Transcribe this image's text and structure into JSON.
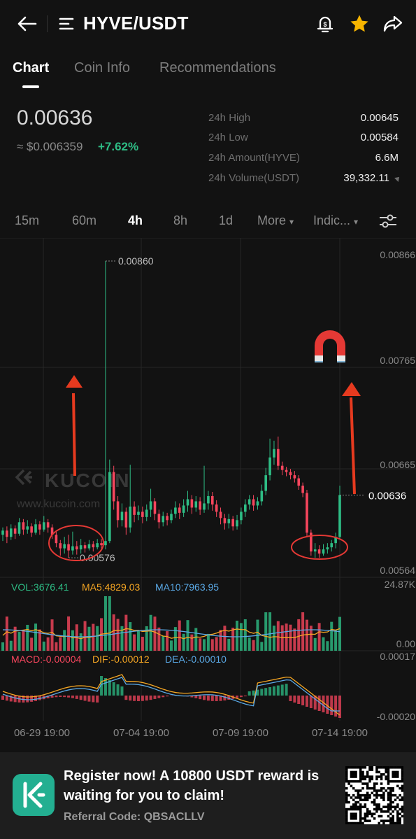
{
  "header": {
    "pair": "HYVE/USDT",
    "icons": [
      "back-arrow-icon",
      "menu-icon",
      "price-alert-bell-icon",
      "favorite-star-icon",
      "share-icon"
    ],
    "favorite_color": "#f7b500"
  },
  "tabs": [
    {
      "label": "Chart",
      "active": true
    },
    {
      "label": "Coin Info",
      "active": false
    },
    {
      "label": "Recommendations",
      "active": false
    }
  ],
  "ticker": {
    "last_price": "0.00636",
    "fiat_price": "≈ $0.006359",
    "change": "+7.62%",
    "stats": [
      {
        "label": "24h High",
        "value": "0.00645"
      },
      {
        "label": "24h Low",
        "value": "0.00584"
      },
      {
        "label": "24h Amount(HYVE)",
        "value": "6.6M"
      },
      {
        "label": "24h Volume(USDT)",
        "value": "39,332.11"
      }
    ]
  },
  "timeframes": {
    "items": [
      "15m",
      "60m",
      "4h",
      "8h",
      "1d",
      "More",
      "Indic..."
    ],
    "active": "4h"
  },
  "chart_data": {
    "type": "candlestick",
    "watermark": "KUCOIN",
    "watermark_url": "www.kucoin.com",
    "price_axis_labels": [
      "0.00866",
      "0.00765",
      "0.00665",
      "0.00564"
    ],
    "current_price_label": "0.00636",
    "high_marker": "0.00860",
    "low_marker": "0.00576",
    "date_labels": [
      "06-29 19:00",
      "07-04 19:00",
      "07-09 19:00",
      "07-14 19:00"
    ],
    "colors": {
      "up": "#2ebd85",
      "down": "#f6465d",
      "bg": "#121212",
      "grid": "#262626"
    },
    "volume": {
      "header": {
        "vol": "VOL:3676.41",
        "ma5": "MA5:4829.03",
        "ma10": "MA10:7963.95"
      },
      "axis_top": "24.87K",
      "axis_bottom": "0.00"
    },
    "macd": {
      "header": {
        "macd": "MACD:-0.00004",
        "dif": "DIF:-0.00012",
        "dea": "DEA:-0.00010"
      },
      "axis_top": "0.00017",
      "axis_bottom": "-0.00020"
    },
    "candles": [
      [
        0.00598,
        0.00602,
        0.00592,
        0.00605
      ],
      [
        0.00602,
        0.00596,
        0.0059,
        0.00606
      ],
      [
        0.00596,
        0.00604,
        0.00593,
        0.00608
      ],
      [
        0.00604,
        0.00599,
        0.00594,
        0.00607
      ],
      [
        0.00599,
        0.0061,
        0.00597,
        0.00614
      ],
      [
        0.0061,
        0.00603,
        0.00598,
        0.00613
      ],
      [
        0.00603,
        0.00606,
        0.00599,
        0.00612
      ],
      [
        0.00606,
        0.006,
        0.00596,
        0.00609
      ],
      [
        0.006,
        0.00608,
        0.00598,
        0.00613
      ],
      [
        0.00608,
        0.00603,
        0.00598,
        0.00611
      ],
      [
        0.00603,
        0.0061,
        0.00601,
        0.00616
      ],
      [
        0.0061,
        0.00605,
        0.006,
        0.00613
      ],
      [
        0.00605,
        0.00598,
        0.00594,
        0.00608
      ],
      [
        0.00598,
        0.0059,
        0.00586,
        0.00601
      ],
      [
        0.0059,
        0.00585,
        0.00578,
        0.00593
      ],
      [
        0.00585,
        0.00589,
        0.0058,
        0.00596
      ],
      [
        0.00589,
        0.00583,
        0.00576,
        0.00598
      ],
      [
        0.00583,
        0.00587,
        0.00579,
        0.00601
      ],
      [
        0.00587,
        0.00584,
        0.00579,
        0.00592
      ],
      [
        0.00584,
        0.00588,
        0.0058,
        0.00594
      ],
      [
        0.00588,
        0.00585,
        0.00581,
        0.00591
      ],
      [
        0.00585,
        0.00589,
        0.00583,
        0.00593
      ],
      [
        0.00589,
        0.00586,
        0.00582,
        0.00592
      ],
      [
        0.00586,
        0.0059,
        0.00584,
        0.00594
      ],
      [
        0.0059,
        0.00588,
        0.00585,
        0.00594
      ],
      [
        0.00588,
        0.00592,
        0.00584,
        0.0086
      ],
      [
        0.00592,
        0.00658,
        0.0059,
        0.0067
      ],
      [
        0.00658,
        0.0063,
        0.00622,
        0.00664
      ],
      [
        0.0063,
        0.00612,
        0.00605,
        0.00635
      ],
      [
        0.00612,
        0.0062,
        0.00606,
        0.00628
      ],
      [
        0.0062,
        0.00605,
        0.00598,
        0.00624
      ],
      [
        0.00605,
        0.00625,
        0.006,
        0.00665
      ],
      [
        0.00625,
        0.00617,
        0.0061,
        0.0063
      ],
      [
        0.00617,
        0.0062,
        0.00612,
        0.00626
      ],
      [
        0.0062,
        0.00615,
        0.00609,
        0.00625
      ],
      [
        0.00615,
        0.00622,
        0.00611,
        0.00627
      ],
      [
        0.00622,
        0.0063,
        0.00615,
        0.00642
      ],
      [
        0.0063,
        0.00618,
        0.00612,
        0.00633
      ],
      [
        0.00618,
        0.0061,
        0.00604,
        0.00622
      ],
      [
        0.0061,
        0.00616,
        0.00606,
        0.0062
      ],
      [
        0.00616,
        0.00612,
        0.00607,
        0.00619
      ],
      [
        0.00612,
        0.00618,
        0.00609,
        0.00622
      ],
      [
        0.00618,
        0.00624,
        0.00614,
        0.0063
      ],
      [
        0.00624,
        0.00619,
        0.00613,
        0.00628
      ],
      [
        0.00619,
        0.00626,
        0.00615,
        0.00632
      ],
      [
        0.00626,
        0.00632,
        0.0062,
        0.0064
      ],
      [
        0.00632,
        0.00624,
        0.00618,
        0.00636
      ],
      [
        0.00624,
        0.0063,
        0.0062,
        0.00635
      ],
      [
        0.0063,
        0.00622,
        0.00617,
        0.00634
      ],
      [
        0.00622,
        0.00628,
        0.00619,
        0.00664
      ],
      [
        0.00628,
        0.00635,
        0.00622,
        0.0064
      ],
      [
        0.00635,
        0.00627,
        0.00621,
        0.00639
      ],
      [
        0.00627,
        0.0062,
        0.00615,
        0.00631
      ],
      [
        0.0062,
        0.00614,
        0.00608,
        0.00624
      ],
      [
        0.00614,
        0.00609,
        0.00603,
        0.00618
      ],
      [
        0.00609,
        0.00613,
        0.00604,
        0.00618
      ],
      [
        0.00613,
        0.00606,
        0.00602,
        0.00616
      ],
      [
        0.00606,
        0.00612,
        0.00603,
        0.00617
      ],
      [
        0.00612,
        0.0062,
        0.00608,
        0.00624
      ],
      [
        0.0062,
        0.00627,
        0.00615,
        0.00632
      ],
      [
        0.00627,
        0.00632,
        0.00622,
        0.00636
      ],
      [
        0.00632,
        0.00626,
        0.00621,
        0.00636
      ],
      [
        0.00626,
        0.0063,
        0.00622,
        0.00634
      ],
      [
        0.0063,
        0.0064,
        0.00626,
        0.00646
      ],
      [
        0.0064,
        0.00655,
        0.00636,
        0.00662
      ],
      [
        0.00655,
        0.00672,
        0.0065,
        0.0069
      ],
      [
        0.00672,
        0.0068,
        0.00665,
        0.00688
      ],
      [
        0.0068,
        0.00664,
        0.0066,
        0.00692
      ],
      [
        0.00664,
        0.0066,
        0.00655,
        0.00668
      ],
      [
        0.0066,
        0.00658,
        0.00654,
        0.00663
      ],
      [
        0.00658,
        0.00655,
        0.00651,
        0.00661
      ],
      [
        0.00655,
        0.00652,
        0.00648,
        0.00659
      ],
      [
        0.00652,
        0.00645,
        0.00641,
        0.00655
      ],
      [
        0.00645,
        0.00638,
        0.00634,
        0.00648
      ],
      [
        0.00638,
        0.006,
        0.00596,
        0.00641
      ],
      [
        0.006,
        0.00582,
        0.00578,
        0.00603
      ],
      [
        0.00582,
        0.00584,
        0.00576,
        0.0059
      ],
      [
        0.00584,
        0.0058,
        0.00576,
        0.00588
      ],
      [
        0.0058,
        0.00584,
        0.00578,
        0.00589
      ],
      [
        0.00584,
        0.00586,
        0.0058,
        0.0059
      ],
      [
        0.00586,
        0.0059,
        0.00582,
        0.00593
      ],
      [
        0.0059,
        0.00596,
        0.00585,
        0.006
      ],
      [
        0.00596,
        0.00636,
        0.00594,
        0.00645
      ]
    ]
  },
  "banner": {
    "text": "Register now! A 10800 USDT reward is waiting for you to claim!",
    "referral": "Referral Code: QBSACLLV"
  }
}
